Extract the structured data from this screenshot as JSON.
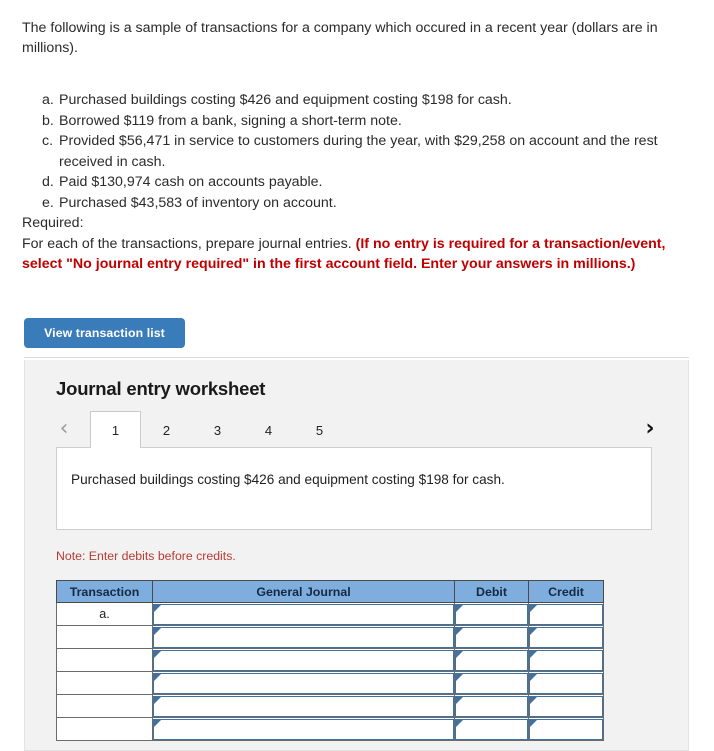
{
  "intro": {
    "paragraph": "The following is a sample of transactions for a company which occured in a recent year (dollars are in millions)."
  },
  "transactions": [
    {
      "letter": "a.",
      "text": "Purchased buildings costing $426 and equipment costing $198 for cash."
    },
    {
      "letter": "b.",
      "text": "Borrowed $119 from a bank, signing a short-term note."
    },
    {
      "letter": "c.",
      "text": "Provided $56,471 in service to customers during the year, with $29,258 on account and the rest received in cash."
    },
    {
      "letter": "d.",
      "text": "Paid $130,974 cash on accounts payable."
    },
    {
      "letter": "e.",
      "text": "Purchased $43,583 of inventory on account."
    }
  ],
  "required": {
    "label": "Required:",
    "instruction": "For each of the transactions, prepare journal entries.",
    "emphasis": "(If no entry is required for a transaction/event, select \"No journal entry required\" in the first account field. Enter your answers in millions.)",
    "emphasis_color": "#c00000"
  },
  "buttons": {
    "view_transaction_list": "View transaction list",
    "primary_color": "#3a7cb9"
  },
  "worksheet": {
    "title": "Journal entry worksheet",
    "prev_icon": "chevron-left",
    "next_icon": "chevron-right",
    "prev_glyph": "‹",
    "next_glyph": "›",
    "tabs": [
      {
        "label": "1",
        "active": true
      },
      {
        "label": "2",
        "active": false
      },
      {
        "label": "3",
        "active": false
      },
      {
        "label": "4",
        "active": false
      },
      {
        "label": "5",
        "active": false
      }
    ],
    "prompt": "Purchased buildings costing $426 and equipment costing $198 for cash.",
    "note": "Note: Enter debits before credits.",
    "table": {
      "headers": [
        "Transaction",
        "General Journal",
        "Debit",
        "Credit"
      ],
      "header_bg": "#7fadde",
      "input_border": "#41719c",
      "rows": [
        {
          "transaction": "a.",
          "general_journal": "",
          "debit": "",
          "credit": ""
        },
        {
          "transaction": "",
          "general_journal": "",
          "debit": "",
          "credit": ""
        },
        {
          "transaction": "",
          "general_journal": "",
          "debit": "",
          "credit": ""
        },
        {
          "transaction": "",
          "general_journal": "",
          "debit": "",
          "credit": ""
        },
        {
          "transaction": "",
          "general_journal": "",
          "debit": "",
          "credit": ""
        },
        {
          "transaction": "",
          "general_journal": "",
          "debit": "",
          "credit": ""
        }
      ]
    }
  }
}
